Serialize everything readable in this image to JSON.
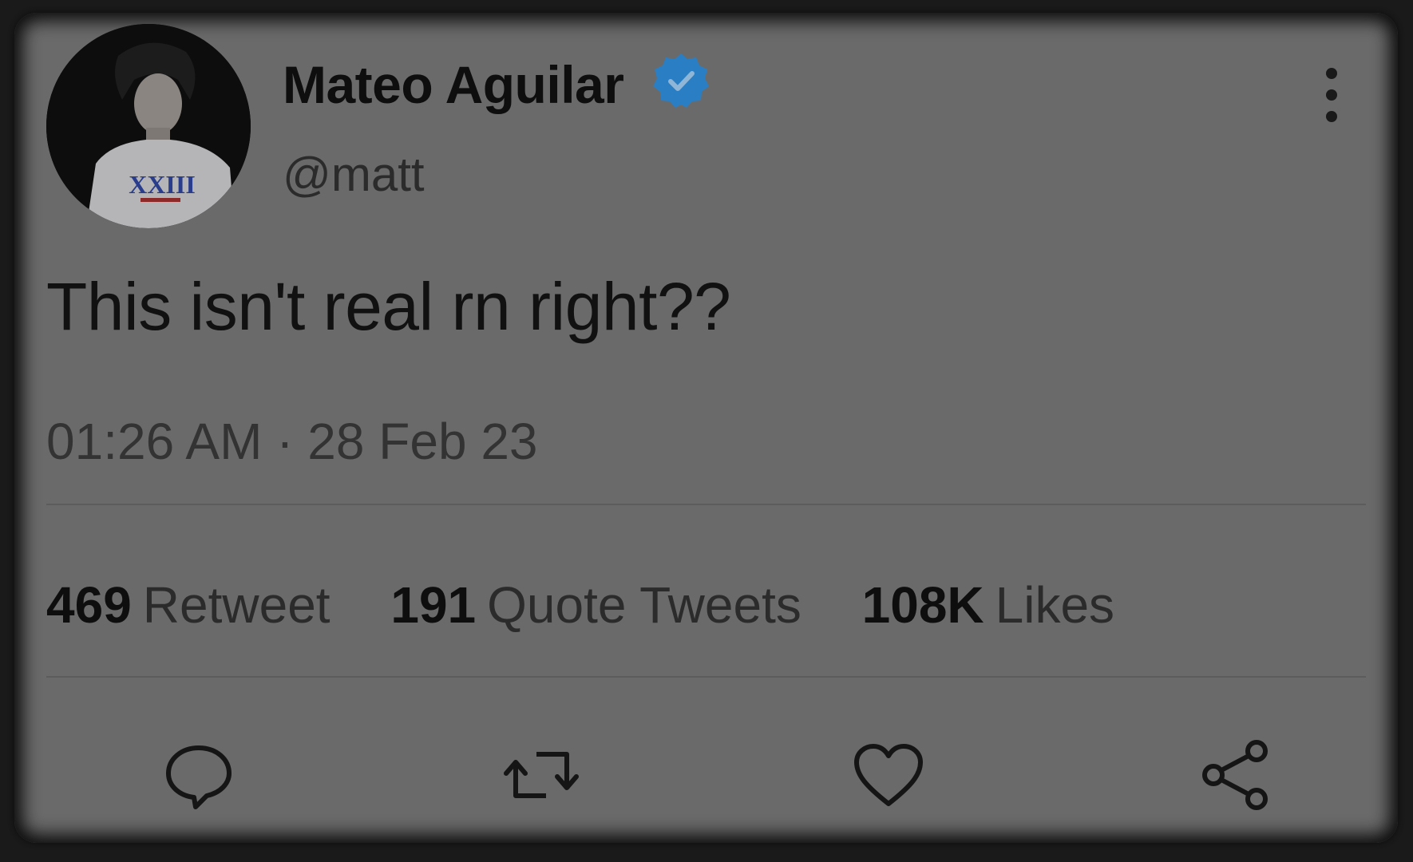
{
  "user": {
    "display_name": "Mateo Aguilar",
    "handle": "@matt",
    "verified": true,
    "avatar_shirt_text": "XXIII"
  },
  "tweet": {
    "text": "This isn't real rn right??",
    "timestamp": "01:26 AM · 28 Feb 23"
  },
  "stats": [
    {
      "count": "469",
      "label": "Retweet"
    },
    {
      "count": "191",
      "label": "Quote Tweets"
    },
    {
      "count": "108K",
      "label": "Likes"
    }
  ],
  "actions": [
    {
      "name": "reply",
      "icon": "reply-icon"
    },
    {
      "name": "retweet",
      "icon": "retweet-icon"
    },
    {
      "name": "like",
      "icon": "heart-icon"
    },
    {
      "name": "share",
      "icon": "share-icon"
    }
  ],
  "colors": {
    "verified_blue": "#2a7fc4",
    "card_background": "#6a6a6a",
    "text_primary": "#0e0e0e"
  }
}
